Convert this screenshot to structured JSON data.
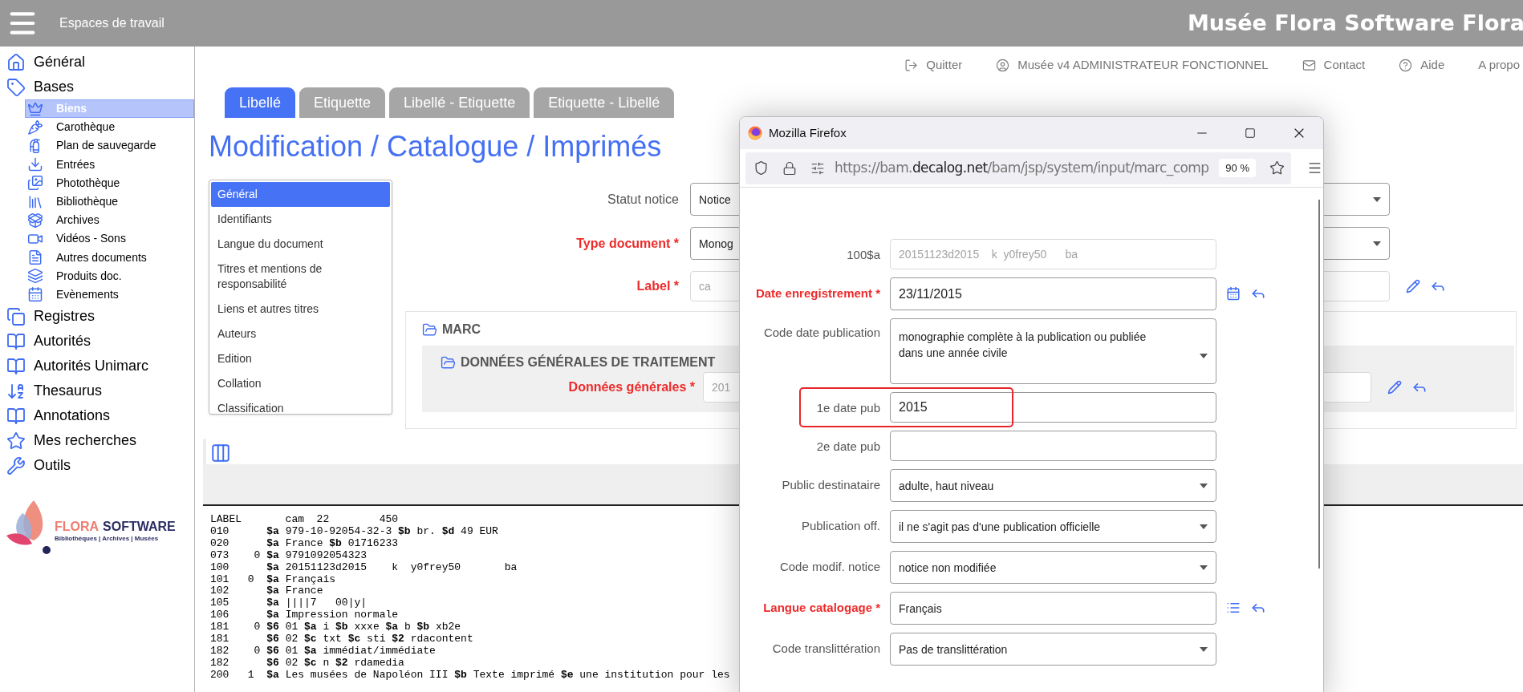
{
  "header": {
    "menu_label": "Espaces de travail",
    "title": "Musée Flora Software Flora"
  },
  "sidebar": {
    "items": [
      {
        "label": "Général"
      },
      {
        "label": "Bases",
        "children": [
          {
            "label": "Biens",
            "selected": true
          },
          {
            "label": "Carothèque",
            "selected": false
          },
          {
            "label": "Plan de sauvegarde",
            "selected": false
          },
          {
            "label": "Entrées",
            "selected": false
          },
          {
            "label": "Photothèque",
            "selected": false
          },
          {
            "label": "Bibliothèque",
            "selected": false
          },
          {
            "label": "Archives",
            "selected": false
          },
          {
            "label": "Vidéos - Sons",
            "selected": false
          },
          {
            "label": "Autres documents",
            "selected": false
          },
          {
            "label": "Produits doc.",
            "selected": false
          },
          {
            "label": "Evènements",
            "selected": false
          }
        ]
      },
      {
        "label": "Registres"
      },
      {
        "label": "Autorités"
      },
      {
        "label": "Autorités Unimarc"
      },
      {
        "label": "Thesaurus"
      },
      {
        "label": "Annotations"
      },
      {
        "label": "Mes recherches"
      },
      {
        "label": "Outils"
      }
    ],
    "logo": {
      "brand_first": "FLORA",
      "brand_second": "SOFTWARE",
      "tagline": "Bibliothèques | Archives | Musées"
    }
  },
  "top_links": [
    {
      "label": "Quitter"
    },
    {
      "label": "Musée v4 ADMINISTRATEUR FONCTIONNEL"
    },
    {
      "label": "Contact"
    },
    {
      "label": "Aide"
    },
    {
      "label": "A propo"
    }
  ],
  "tabs": [
    {
      "label": "Libellé",
      "selected": true
    },
    {
      "label": "Etiquette",
      "selected": false
    },
    {
      "label": "Libellé - Etiquette",
      "selected": false
    },
    {
      "label": "Etiquette - Libellé",
      "selected": false
    }
  ],
  "page_title": "Modification / Catalogue / Imprimés",
  "section_menu": {
    "items": [
      {
        "label": "Général",
        "selected": true
      },
      {
        "label": "Identifiants",
        "selected": false
      },
      {
        "label": "Langue du document",
        "selected": false
      },
      {
        "label": "Titres et mentions de responsabilité",
        "selected": false
      },
      {
        "label": "Liens et autres titres",
        "selected": false
      },
      {
        "label": "Auteurs",
        "selected": false
      },
      {
        "label": "Edition",
        "selected": false
      },
      {
        "label": "Collation",
        "selected": false
      },
      {
        "label": "Classification",
        "selected": false
      }
    ]
  },
  "form": {
    "fields": [
      {
        "label": "Statut notice",
        "required": false,
        "kind": "select",
        "value": "Notice"
      },
      {
        "label": "Type document *",
        "required": true,
        "kind": "select",
        "value": "Monog"
      },
      {
        "label": "Label *",
        "required": true,
        "kind": "edit",
        "value": "ca"
      }
    ]
  },
  "marc": {
    "title": "MARC",
    "group": {
      "title": "DONNÉES GÉNÉRALES DE TRAITEMENT",
      "fields": [
        {
          "label": "Données générales *",
          "required": true,
          "kind": "edit",
          "value": "201"
        }
      ]
    }
  },
  "record_listing": {
    "lines": [
      "LABEL       cam  22        450",
      "010      **$a** 979-10-92054-32-3 **$b** br. **$d** 49 EUR",
      "020      **$a** France **$b** 01716233",
      "073    0 **$a** 9791092054323",
      "100      **$a** 20151123d2015    k  y0frey50       ba",
      "101   0  **$a** Français",
      "102      **$a** France",
      "105      **$a** ||||7   00|y|",
      "106      **$a** Impression normale",
      "181    0 **$6** 01 **$a** i **$b** xxxe **$a** b **$b** xb2e",
      "181      **$6** 02 **$c** txt **$c** sti **$2** rdacontent",
      "182    0 **$6** 01 **$a** immédiat/immédiate",
      "182      **$6** 02 **$c** n **$2** rdamedia",
      "200   1  **$a** Les musées de Napoléon III **$b** Texte imprimé **$e** une institution pour les"
    ]
  },
  "popup": {
    "title": "Mozilla Firefox",
    "url": {
      "before": "https://bam.",
      "domain": "decalog.net",
      "after": "/bam/jsp/system/input/marc_comp"
    },
    "zoom": "90 %",
    "fields": [
      {
        "label": "100$a",
        "required": false,
        "kind": "readonly",
        "value": "20151123d2015    k  y0frey50      ba",
        "highlighted": false
      },
      {
        "label": "Date enregistrement *",
        "required": true,
        "kind": "date",
        "value": "23/11/2015",
        "highlighted": false
      },
      {
        "label": "Code date publication",
        "required": false,
        "kind": "select_tall",
        "value": "monographie complète à la publication ou publiée dans une année civile",
        "highlighted": false
      },
      {
        "label": "1e date pub",
        "required": false,
        "kind": "text",
        "value": "2015",
        "highlighted": true
      },
      {
        "label": "2e date pub",
        "required": false,
        "kind": "text",
        "highlighted": false
      },
      {
        "label": "Public destinataire",
        "required": false,
        "kind": "select",
        "value": "adulte, haut niveau",
        "highlighted": false
      },
      {
        "label": "Publication off.",
        "required": false,
        "kind": "select",
        "value": "il ne s'agit pas d'une publication officielle",
        "highlighted": false
      },
      {
        "label": "Code modif. notice",
        "required": false,
        "kind": "select",
        "value": "notice non modifiée",
        "highlighted": false
      },
      {
        "label": "Langue catalogage *",
        "required": true,
        "kind": "lookup",
        "value": "Français",
        "highlighted": false
      },
      {
        "label": "Code translittération",
        "required": false,
        "kind": "select",
        "value": "Pas de translittération",
        "highlighted": false
      }
    ]
  }
}
